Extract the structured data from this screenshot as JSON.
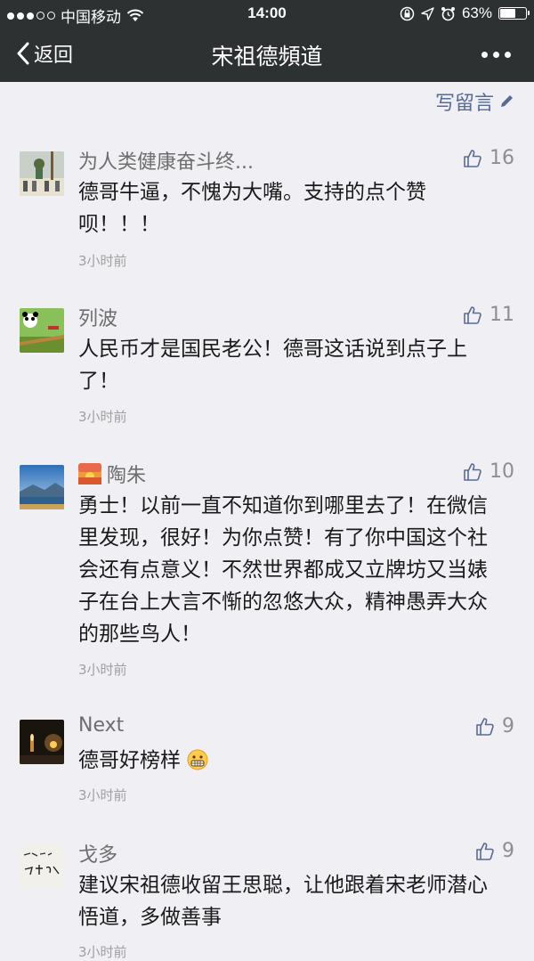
{
  "status_bar": {
    "carrier": "中国移动",
    "time": "14:00",
    "battery": "63%",
    "battery_level": 0.63
  },
  "nav": {
    "back_label": "返回",
    "title": "宋祖德頻道"
  },
  "write_label": "写留言",
  "comments": [
    {
      "name": "为人类健康奋斗终...",
      "likes": "16",
      "text": "德哥牛逼，不愧为大嘴。支持的点个赞呗！！！",
      "time": "3小时前"
    },
    {
      "name": "列波",
      "likes": "11",
      "text": "人民币才是国民老公！德哥这话说到点子上了！",
      "time": "3小时前"
    },
    {
      "name": "陶朱",
      "likes": "10",
      "text": "勇士！以前一直不知道你到哪里去了！在微信里发现，很好！为你点赞！有了你中国这个社会还有点意义！不然世界都成又立牌坊又当婊子在台上大言不惭的忽悠大众，精神愚弄大众的那些鸟人！",
      "time": "3小时前"
    },
    {
      "name": "Next",
      "likes": "9",
      "text": "德哥好榜样",
      "time": "3小时前"
    },
    {
      "name": "戈多",
      "likes": "9",
      "text": "建议宋祖德收留王思聪，让他跟着宋老师潜心悟道，多做善事",
      "time": "3小时前"
    }
  ]
}
